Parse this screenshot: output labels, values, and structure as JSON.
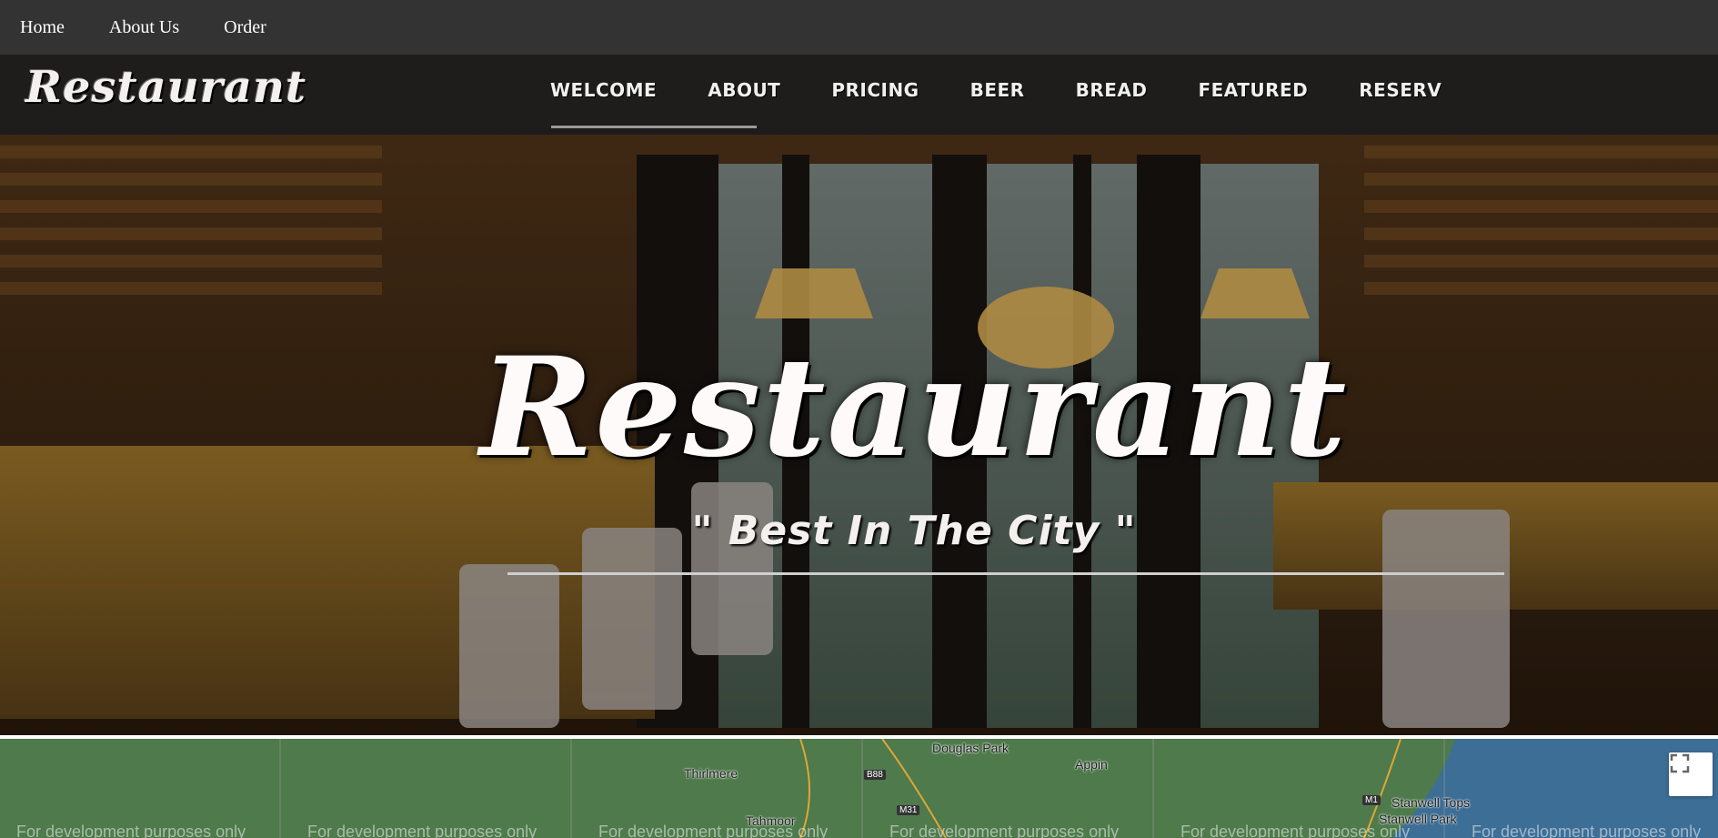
{
  "topnav": {
    "items": [
      "Home",
      "About Us",
      "Order"
    ]
  },
  "site": {
    "logo": "Restaurant",
    "menu": [
      "WELCOME",
      "ABOUT",
      "PRICING",
      "BEER",
      "BREAD",
      "FEATURED",
      "RESERV"
    ]
  },
  "hero": {
    "title": "Restaurant",
    "tagline": "\" Best In The City \""
  },
  "map": {
    "places": [
      "Thirlmere",
      "Douglas Park",
      "Appin",
      "Tahmoor",
      "Stanwell Tops",
      "Stanwell Park"
    ],
    "roads": [
      "B88",
      "M31",
      "M1"
    ],
    "watermark": "For development purposes only",
    "fullscreen_icon": "fullscreen-icon"
  },
  "colors": {
    "topnav": "#333333",
    "header": "#1c1c1c",
    "map_land": "#4e7a4c",
    "map_sea": "#3c6e96"
  }
}
